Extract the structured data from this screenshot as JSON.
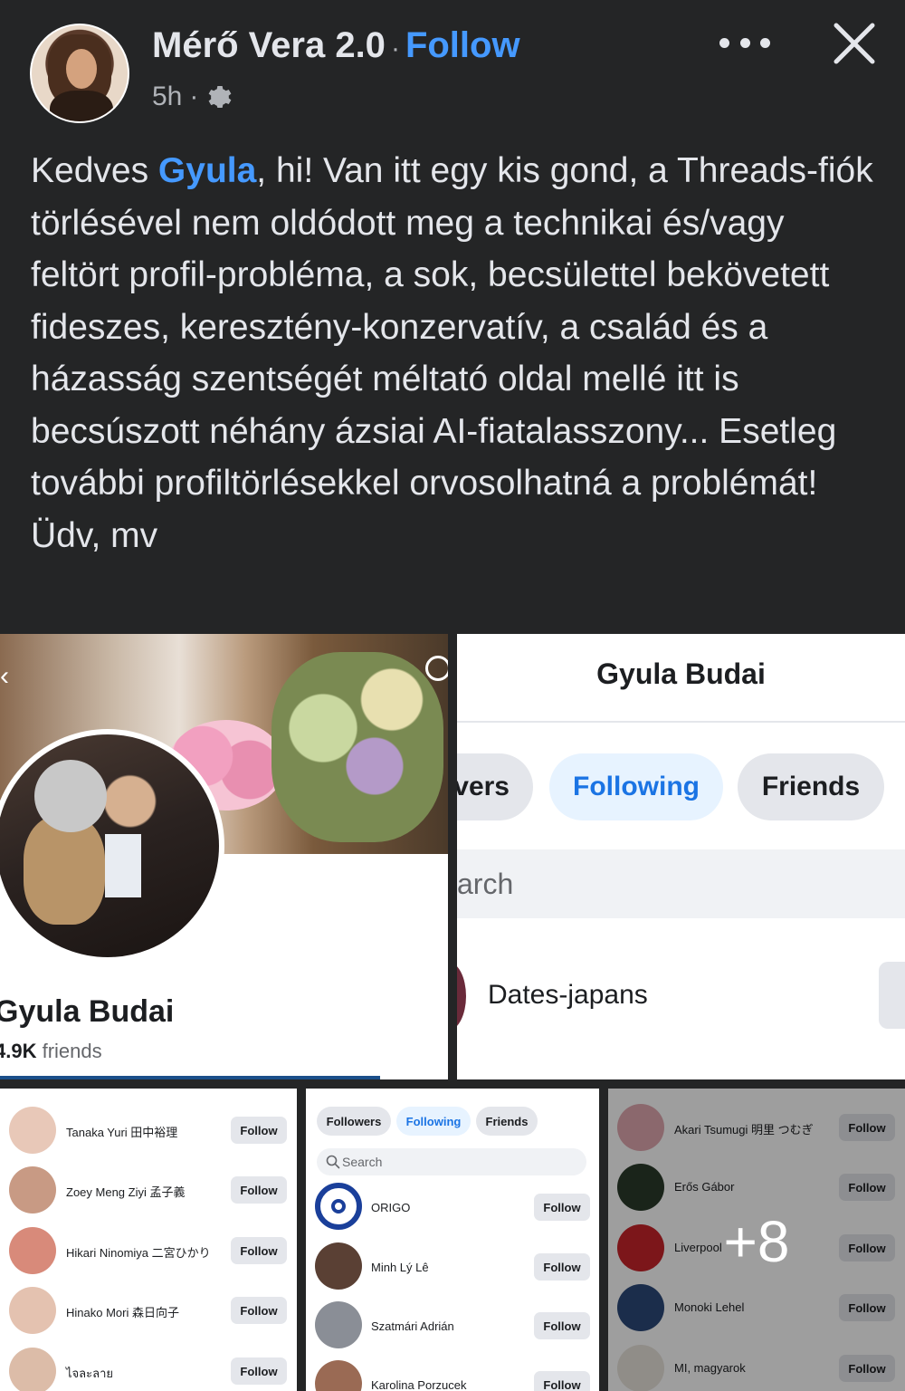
{
  "header": {
    "author": "Mérő Vera 2.0",
    "separator": "·",
    "follow_label": "Follow",
    "time": "5h",
    "meta_sep": "·"
  },
  "post": {
    "greeting": "Kedves ",
    "mention": "Gyula",
    "body": ", hi! Van itt egy kis gond, a Threads-fiók törlésével nem oldódott meg a technikai és/vagy feltört profil-probléma, a sok, becsülettel bekövetett fideszes, keresztény-konzervatív, a család és a házasság szentségét méltató oldal mellé itt is becsúszott néhány ázsiai AI-fiatalasszony... Esetleg további profiltörlésekkel orvosolhatná a problémát! Üdv, mv"
  },
  "profile_tile": {
    "name": "Gyula Budai",
    "friends_count": "4.9K",
    "friends_label": " friends"
  },
  "following_tile": {
    "title": "Gyula Budai",
    "tab_followers": "vers",
    "tab_following": "Following",
    "tab_friends": "Friends",
    "search_placeholder": "arch",
    "first_row": "Dates-japans"
  },
  "list_left": [
    {
      "name": "Tanaka Yuri 田中裕理",
      "button": "Follow"
    },
    {
      "name": "Zoey Meng Ziyi 孟子義",
      "button": "Follow"
    },
    {
      "name": "Hikari Ninomiya 二宮ひかり",
      "button": "Follow"
    },
    {
      "name": "Hinako Mori 森日向子",
      "button": "Follow"
    },
    {
      "name": "ไจละลาย",
      "button": "Follow"
    }
  ],
  "list_middle": {
    "tabs": [
      "Followers",
      "Following",
      "Friends"
    ],
    "search_placeholder": "Search",
    "rows": [
      {
        "name": "ORIGO",
        "button": "Follow"
      },
      {
        "name": "Minh Lý Lê",
        "button": "Follow"
      },
      {
        "name": "Szatmári Adrián",
        "button": "Follow"
      },
      {
        "name": "Karolina Porzucek",
        "button": "Follow"
      }
    ]
  },
  "list_right": {
    "more_count": "+8",
    "rows": [
      {
        "name": "Akari Tsumugi 明里 つむぎ",
        "button": "Follow"
      },
      {
        "name": "Erős Gábor",
        "button": "Follow"
      },
      {
        "name": "Liverpool",
        "button": "Follow"
      },
      {
        "name": "Monoki Lehel",
        "button": "Follow"
      },
      {
        "name": "MI, magyarok",
        "button": "Follow"
      }
    ]
  },
  "colors": {
    "background": "#242526",
    "link": "#4599ff",
    "text": "#e4e6eb",
    "muted": "#b0b3b8",
    "accent": "#1b74e4"
  },
  "icons": {
    "privacy": "gear-icon",
    "more": "more-icon",
    "close": "close-icon",
    "search": "search-icon"
  }
}
